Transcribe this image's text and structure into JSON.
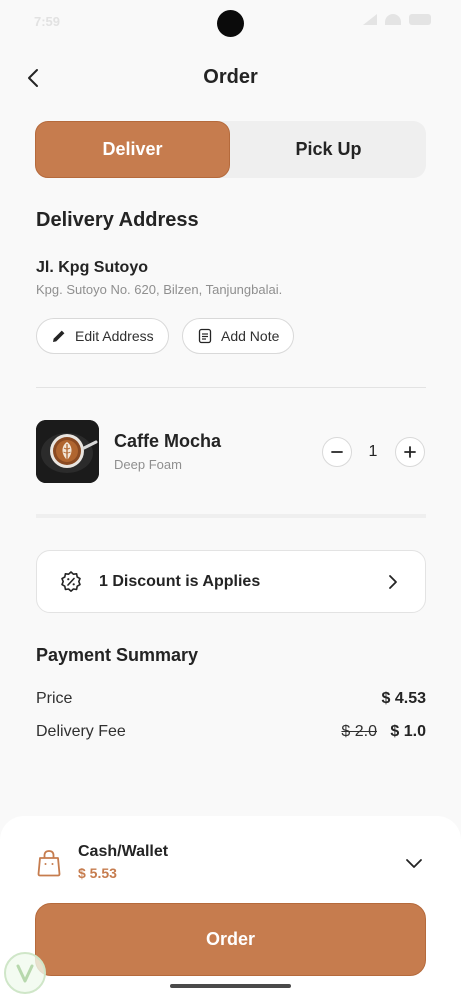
{
  "status_bar": {
    "time": "7:59"
  },
  "header": {
    "title": "Order",
    "back_icon": "chevron-left-icon"
  },
  "mode_tabs": [
    {
      "label": "Deliver",
      "active": true
    },
    {
      "label": "Pick Up",
      "active": false
    }
  ],
  "delivery": {
    "title": "Delivery Address",
    "street": "Jl. Kpg Sutoyo",
    "detail": "Kpg. Sutoyo No. 620, Bilzen, Tanjungbalai.",
    "edit_label": "Edit Address",
    "note_label": "Add Note"
  },
  "item": {
    "name": "Caffe Mocha",
    "variant": "Deep Foam",
    "quantity": "1"
  },
  "discount": {
    "label": "1 Discount is Applies"
  },
  "payment_summary": {
    "title": "Payment Summary",
    "price_label": "Price",
    "price_value": "$ 4.53",
    "fee_label": "Delivery Fee",
    "fee_old": "$ 2.0",
    "fee_value": "$ 1.0"
  },
  "payment_method": {
    "label": "Cash/Wallet",
    "amount": "$ 5.53"
  },
  "order_button": {
    "label": "Order"
  },
  "colors": {
    "accent": "#c67c4e",
    "background": "#f9f9f9",
    "text": "#242424"
  }
}
